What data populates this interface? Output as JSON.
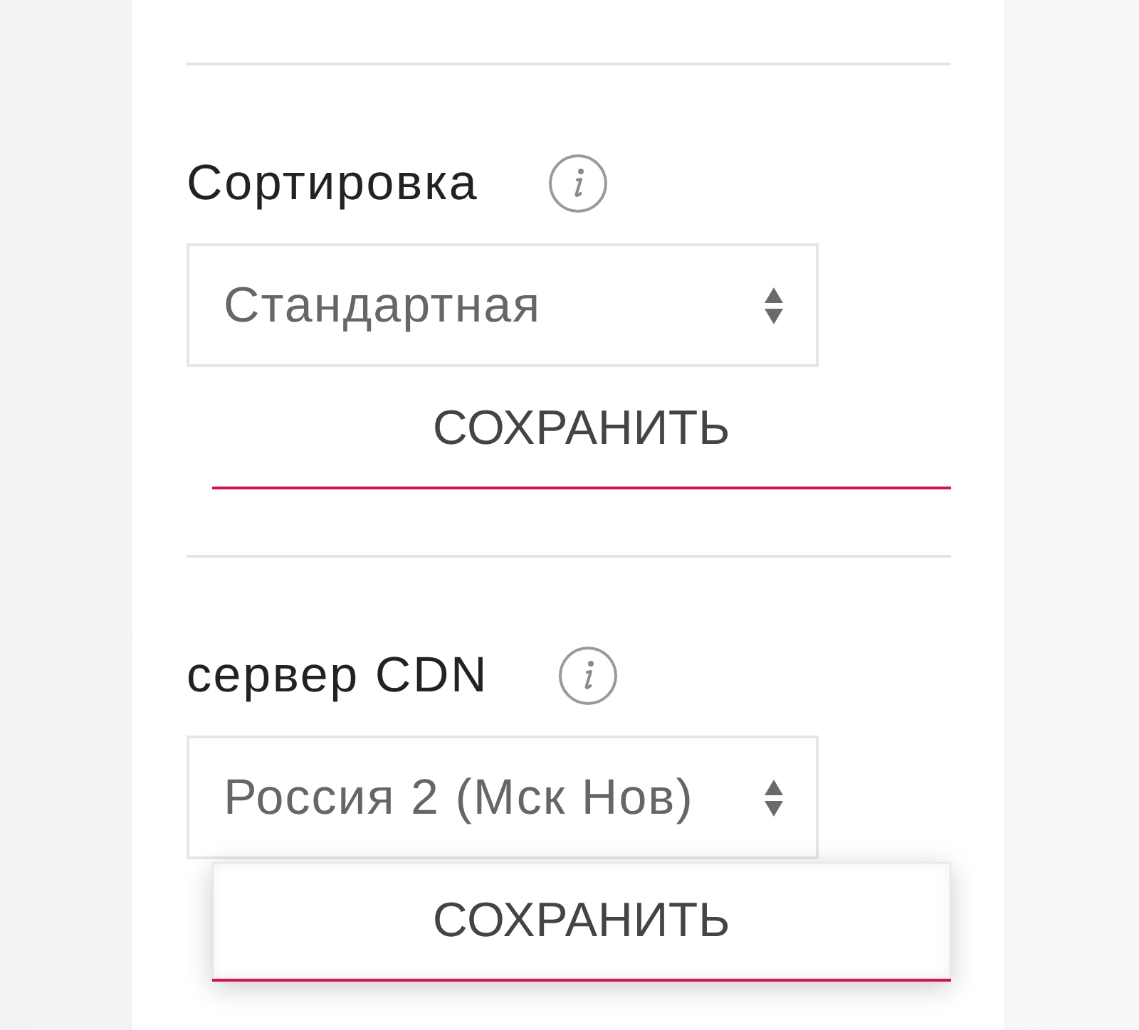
{
  "settings": [
    {
      "label": "Сортировка",
      "select": {
        "value": "Стандартная"
      },
      "save_button": {
        "label": "СОХРАНИТЬ",
        "focused": false
      }
    },
    {
      "label": "сервер CDN",
      "select": {
        "value": "Россия 2 (Мск Нов)"
      },
      "save_button": {
        "label": "СОХРАНИТЬ",
        "focused": true
      }
    }
  ]
}
